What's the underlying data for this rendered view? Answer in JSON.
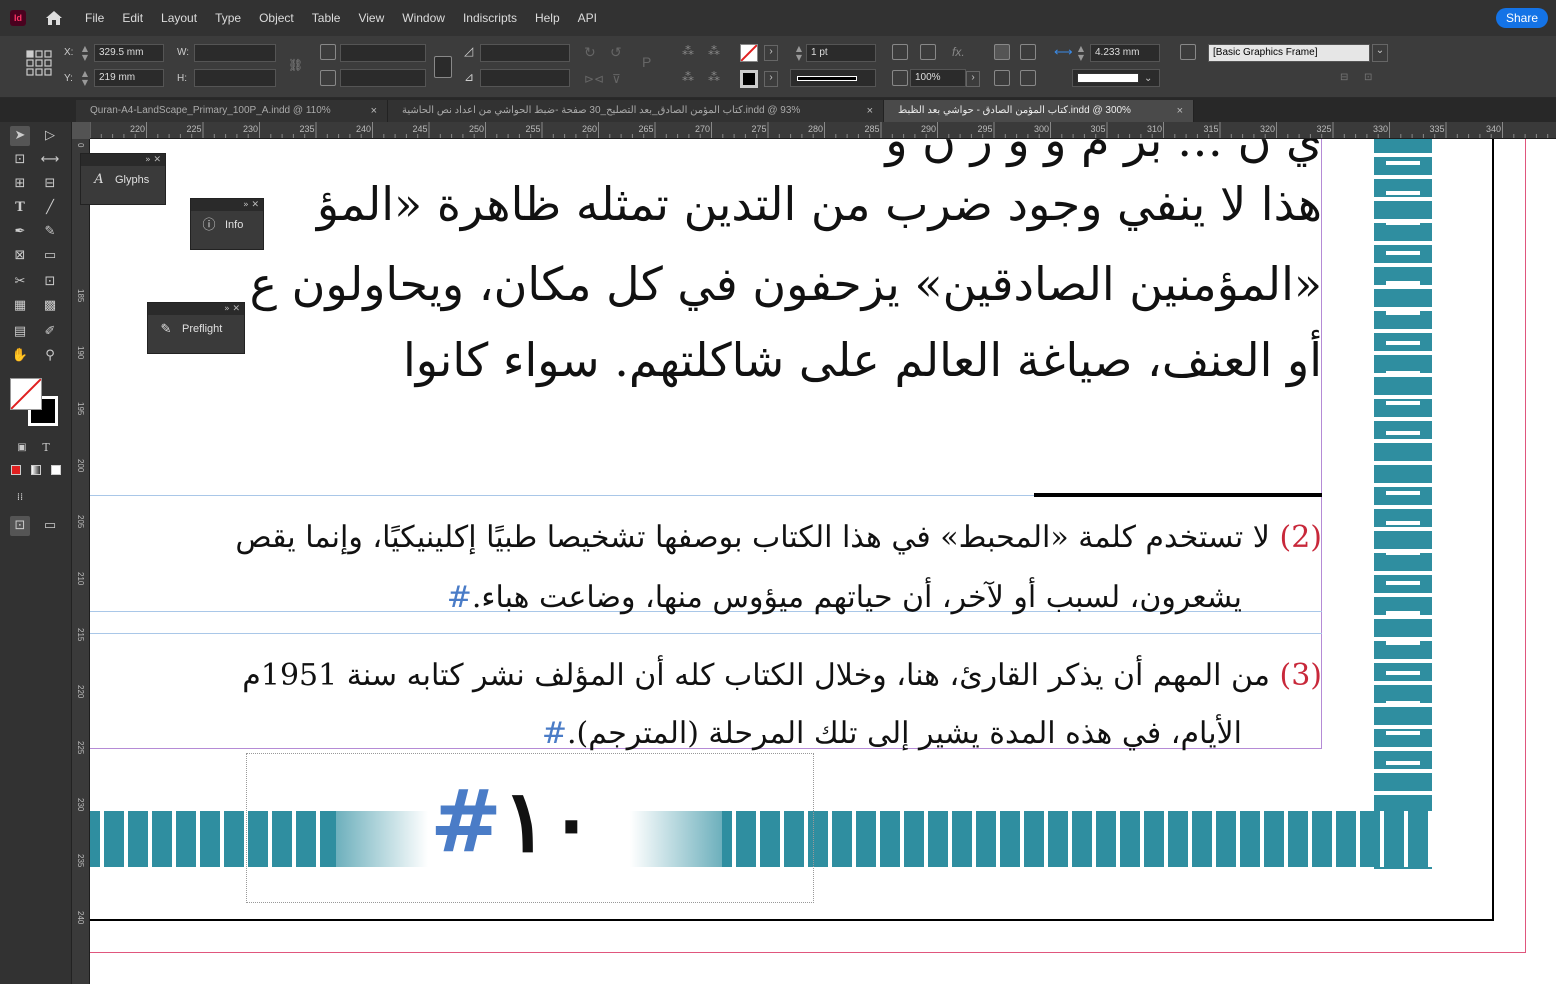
{
  "app": {
    "logo": "Id"
  },
  "menu": [
    "File",
    "Edit",
    "Layout",
    "Type",
    "Object",
    "Table",
    "View",
    "Window",
    "Indiscripts",
    "Help",
    "API"
  ],
  "share_label": "Share",
  "control": {
    "x_label": "X:",
    "x_value": "329.5 mm",
    "y_label": "Y:",
    "y_value": "219 mm",
    "w_label": "W:",
    "h_label": "H:",
    "stroke_weight": "1 pt",
    "opacity": "100%",
    "gap": "4.233 mm",
    "object_style": "[Basic Graphics Frame]"
  },
  "tabs": [
    {
      "label": "Quran-A4-LandScape_Primary_100P_A.indd @ 110%",
      "active": false
    },
    {
      "label": "كتاب المؤمن الصادق_بعد التصليح_30 صفحة -ضبط الحواشي من اعداد نص الحاشية.indd @ 93%",
      "active": false
    },
    {
      "label": "كتاب المؤمن الصادق - حواشي بعد الظبط.indd @ 300%",
      "active": true
    }
  ],
  "tab_close": "×",
  "ruler_h": [
    "220",
    "225",
    "230",
    "235",
    "240",
    "245",
    "250",
    "255",
    "260",
    "265",
    "270",
    "275",
    "280",
    "285",
    "290",
    "295",
    "300",
    "305",
    "310",
    "315",
    "320",
    "325",
    "330",
    "335",
    "340"
  ],
  "ruler_v": [
    "0",
    "185",
    "190",
    "195",
    "200",
    "205",
    "210",
    "215",
    "220",
    "225",
    "230",
    "235",
    "240"
  ],
  "panels": {
    "glyphs": "Glyphs",
    "info": "Info",
    "preflight": "Preflight"
  },
  "document": {
    "main_lines": [
      "هذا لا ينفي وجود ضرب من التدين تمثله ظاهرة «المؤ",
      "«المؤمنين الصادقين» يزحفون في كل مكان، ويحاولون ع",
      "أو العنف، صياغة العالم على شاكلتهم. سواء كانوا"
    ],
    "footnote_2": {
      "num": "(2)",
      "line1": "لا تستخدم كلمة «المحبط» في هذا الكتاب بوصفها تشخيصا طبيًا إكلينيكيًا، وإنما يقص",
      "line2": "يشعرون، لسبب أو لآخر، أن حياتهم ميؤوس منها، وضاعت هباء.",
      "hash": "#"
    },
    "footnote_3": {
      "num": "(3)",
      "line1": "من المهم أن يذكر القارئ، هنا، وخلال الكتاب كله أن المؤلف نشر كتابه سنة 1951م",
      "line2": "الأيام، في هذه المدة يشير إلى تلك المرحلة (المترجم).",
      "hash": "#"
    },
    "page_number": "١٠",
    "page_hash": "#"
  }
}
